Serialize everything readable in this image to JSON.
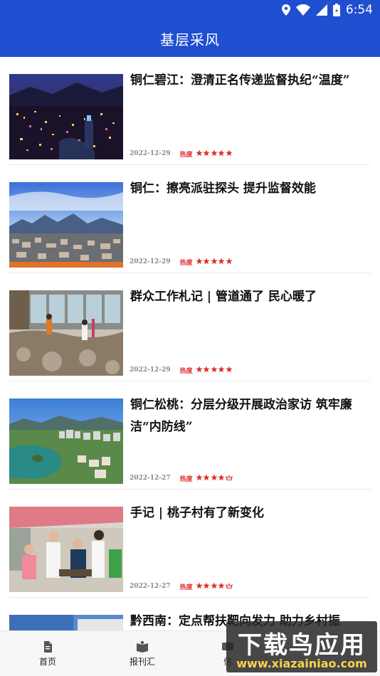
{
  "status_bar": {
    "time": "6:54"
  },
  "header": {
    "title": "基层采风"
  },
  "heat_label": "热度",
  "articles": [
    {
      "headline": "铜仁碧江：澄清正名传递监督执纪“温度”",
      "date": "2022-12-29",
      "heat_stars": 5,
      "image": "night-city-photo"
    },
    {
      "headline": "铜仁：擦亮派驻探头 提升监督效能",
      "date": "2022-12-29",
      "heat_stars": 5,
      "image": "mountain-city-photo"
    },
    {
      "headline": "群众工作札记 | 管道通了 民心暖了",
      "date": "2022-12-29",
      "heat_stars": 5,
      "image": "construction-site-photo"
    },
    {
      "headline": "铜仁松桃：分层分级开展政治家访 筑牢廉洁“内防线”",
      "date": "2022-12-27",
      "heat_stars": 4,
      "image": "lake-town-photo"
    },
    {
      "headline": "手记 | 桃子村有了新变化",
      "date": "2022-12-27",
      "heat_stars": 4,
      "image": "village-visit-photo"
    },
    {
      "headline": "黔西南：定点帮扶靶向发力 助力乡村振",
      "date": "",
      "heat_stars": 0,
      "image": "building-photo"
    }
  ],
  "tabs": [
    {
      "label": "首页",
      "icon": "document-icon"
    },
    {
      "label": "报刊汇",
      "icon": "book-icon"
    },
    {
      "label": "信",
      "icon": "message-icon"
    }
  ],
  "watermark": {
    "title": "下载鸟应用",
    "url": "www.xiazainiao.com"
  },
  "colors": {
    "brand_blue": "#1f4fd0",
    "heat_red": "#e03030"
  }
}
